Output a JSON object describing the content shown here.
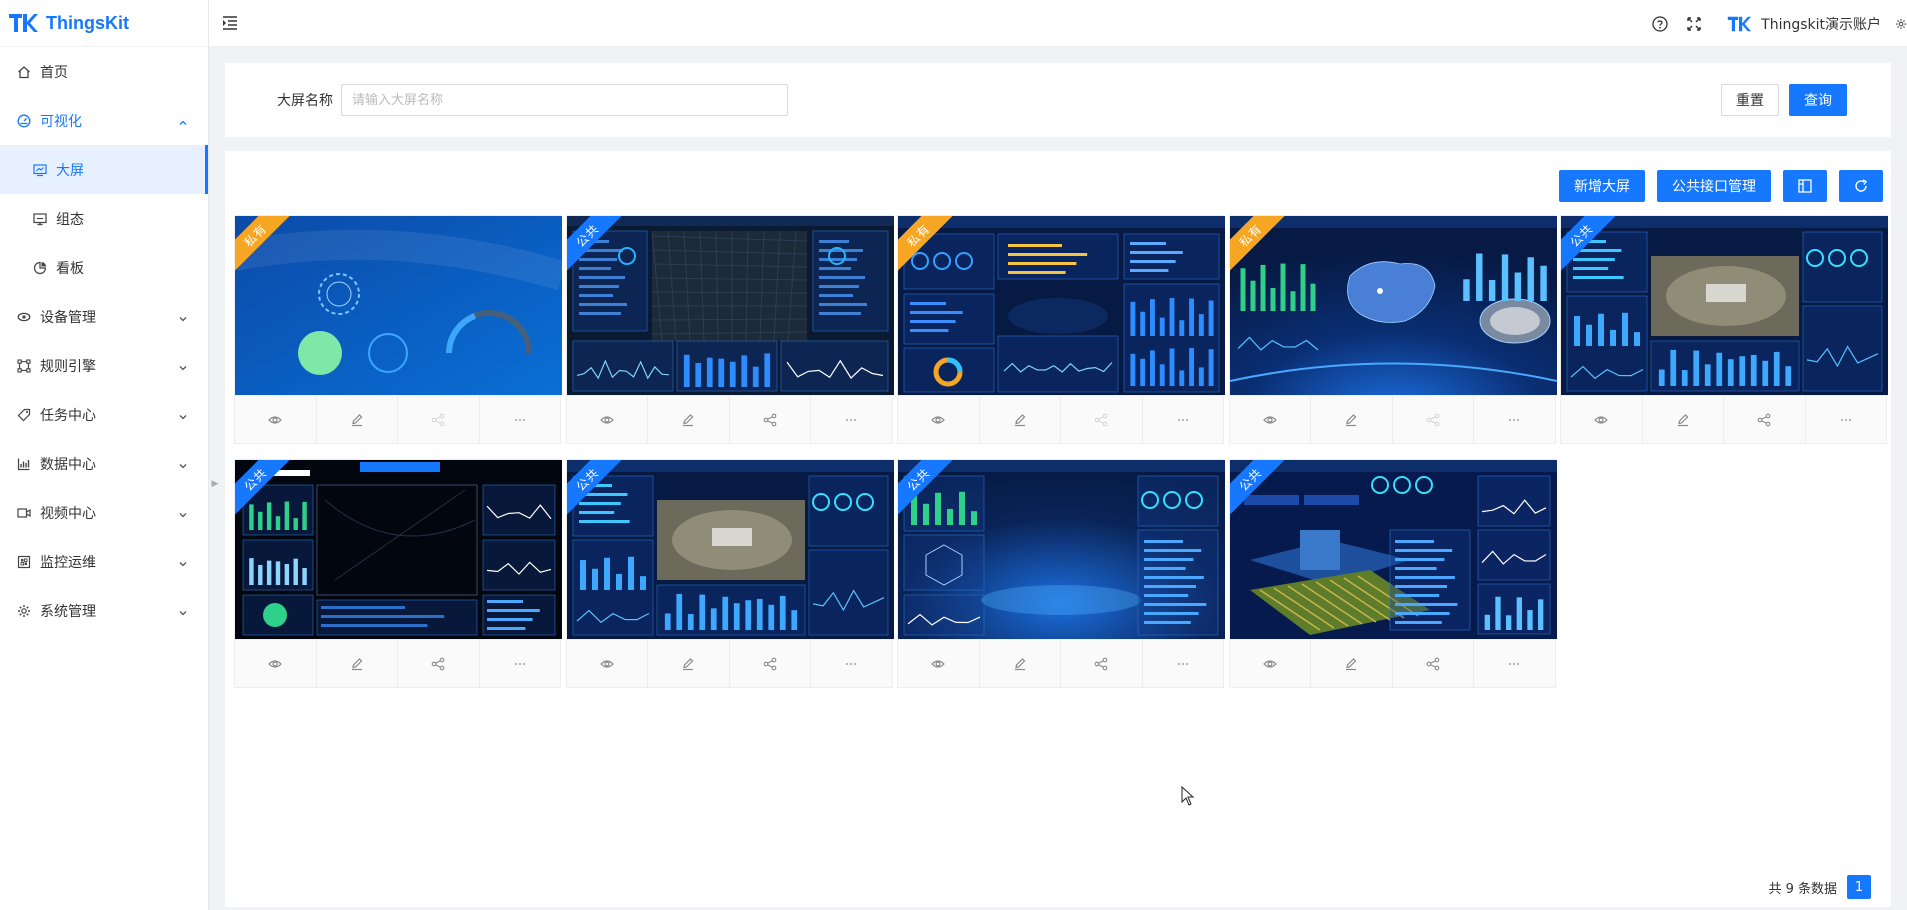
{
  "app": {
    "name": "ThingsKit"
  },
  "header": {
    "user_name": "Thingskit演示账户"
  },
  "sidebar": {
    "items": [
      {
        "label": "首页",
        "icon": "home-icon"
      },
      {
        "label": "可视化",
        "icon": "dashboard-icon",
        "open": true,
        "children": [
          {
            "label": "大屏",
            "icon": "screen-icon",
            "active": true
          },
          {
            "label": "组态",
            "icon": "monitor-icon"
          },
          {
            "label": "看板",
            "icon": "pie-icon"
          }
        ]
      },
      {
        "label": "设备管理",
        "icon": "device-icon"
      },
      {
        "label": "规则引擎",
        "icon": "rule-icon"
      },
      {
        "label": "任务中心",
        "icon": "tag-icon"
      },
      {
        "label": "数据中心",
        "icon": "bar-chart-icon"
      },
      {
        "label": "视频中心",
        "icon": "video-icon"
      },
      {
        "label": "监控运维",
        "icon": "ops-icon"
      },
      {
        "label": "系统管理",
        "icon": "gear-icon"
      }
    ]
  },
  "search": {
    "label": "大屏名称",
    "placeholder": "请输入大屏名称",
    "value": "",
    "reset_label": "重置",
    "query_label": "查询"
  },
  "toolbar": {
    "add_label": "新增大屏",
    "api_label": "公共接口管理"
  },
  "cards": [
    {
      "tag": "私有",
      "type": "private",
      "theme": "gauge",
      "share_enabled": false
    },
    {
      "tag": "公共",
      "type": "public",
      "theme": "city",
      "share_enabled": true
    },
    {
      "tag": "私有",
      "type": "private",
      "theme": "factory",
      "share_enabled": false
    },
    {
      "tag": "私有",
      "type": "private",
      "theme": "map",
      "share_enabled": false
    },
    {
      "tag": "公共",
      "type": "public",
      "theme": "park",
      "share_enabled": true
    },
    {
      "tag": "公共",
      "type": "public",
      "theme": "dark",
      "share_enabled": true
    },
    {
      "tag": "公共",
      "type": "public",
      "theme": "park",
      "share_enabled": true
    },
    {
      "tag": "公共",
      "type": "public",
      "theme": "hex",
      "share_enabled": true
    },
    {
      "tag": "公共",
      "type": "public",
      "theme": "farm",
      "share_enabled": true
    }
  ],
  "pagination": {
    "total_text": "共 9 条数据",
    "current_page": "1"
  }
}
